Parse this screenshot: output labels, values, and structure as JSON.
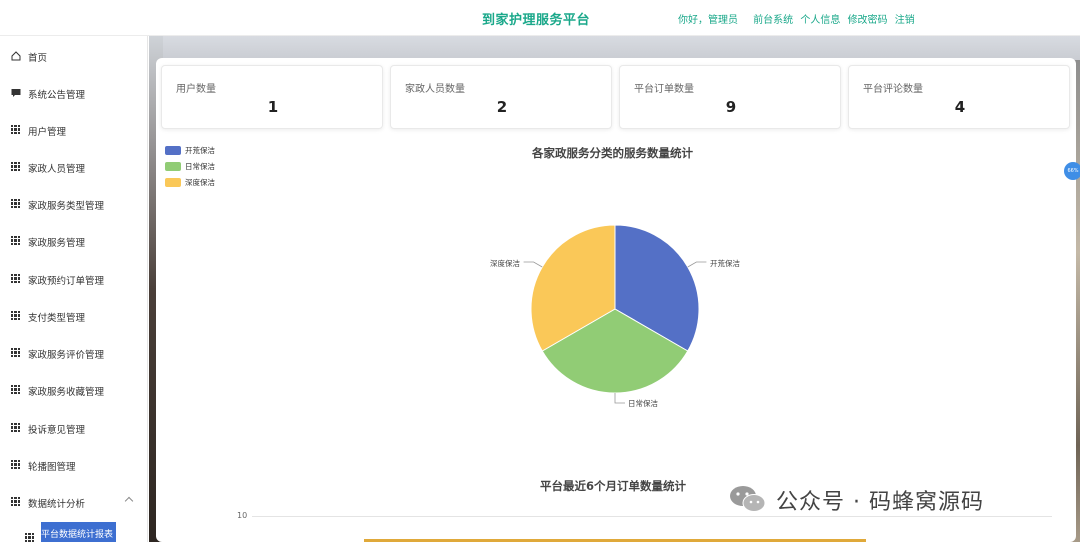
{
  "header": {
    "title": "到家护理服务平台",
    "greeting": "你好，管理员",
    "links": [
      "前台系统",
      "个人信息",
      "修改密码",
      "注销"
    ]
  },
  "sidebar": {
    "items": [
      {
        "label": "首页",
        "icon": "home-icon"
      },
      {
        "label": "系统公告管理",
        "icon": "message-icon"
      },
      {
        "label": "用户管理",
        "icon": "grid-icon"
      },
      {
        "label": "家政人员管理",
        "icon": "grid-icon"
      },
      {
        "label": "家政服务类型管理",
        "icon": "grid-icon"
      },
      {
        "label": "家政服务管理",
        "icon": "grid-icon"
      },
      {
        "label": "家政预约订单管理",
        "icon": "grid-icon"
      },
      {
        "label": "支付类型管理",
        "icon": "grid-icon"
      },
      {
        "label": "家政服务评价管理",
        "icon": "grid-icon"
      },
      {
        "label": "家政服务收藏管理",
        "icon": "grid-icon"
      },
      {
        "label": "投诉意见管理",
        "icon": "grid-icon"
      },
      {
        "label": "轮播图管理",
        "icon": "grid-icon"
      },
      {
        "label": "数据统计分析",
        "icon": "grid-icon"
      }
    ],
    "active_sub": "平台数据统计报表"
  },
  "stats": [
    {
      "title": "用户数量",
      "value": "1"
    },
    {
      "title": "家政人员数量",
      "value": "2"
    },
    {
      "title": "平台订单数量",
      "value": "9"
    },
    {
      "title": "平台评论数量",
      "value": "4"
    }
  ],
  "colors": {
    "accent": "#1aa88a",
    "blue": "#5470c6",
    "green": "#91cc75",
    "yellow": "#fac858",
    "menu_active": "#3d6fd1"
  },
  "chart_data": [
    {
      "type": "pie",
      "title": "各家政服务分类的服务数量统计",
      "legend_position": "top-left",
      "categories": [
        "开荒保洁",
        "日常保洁",
        "深度保洁"
      ],
      "values": [
        1,
        1,
        1
      ],
      "colors": [
        "#5470c6",
        "#91cc75",
        "#fac858"
      ]
    },
    {
      "type": "bar",
      "title": "平台最近6个月订单数量统计",
      "y_ticks": [
        "10"
      ]
    }
  ],
  "side_badge": "66%",
  "watermark": "公众号 · 码蜂窝源码"
}
